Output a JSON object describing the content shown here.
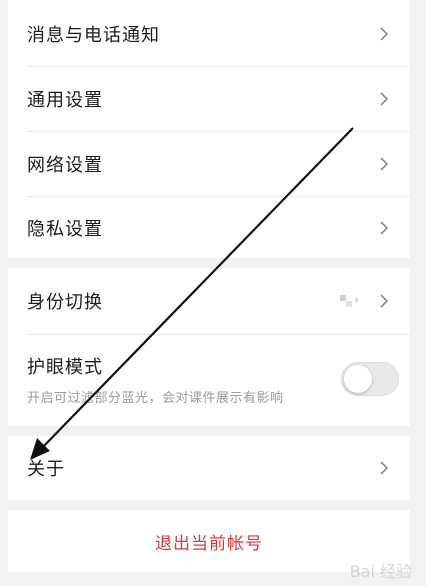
{
  "settings": {
    "group1": [
      {
        "label": "消息与电话通知"
      },
      {
        "label": "通用设置"
      },
      {
        "label": "网络设置"
      },
      {
        "label": "隐私设置"
      }
    ],
    "identity": {
      "label": "身份切换"
    },
    "eye_mode": {
      "label": "护眼模式",
      "description": "开启可过滤部分蓝光，会对课件展示有影响",
      "enabled": false
    },
    "about": {
      "label": "关于"
    },
    "logout": {
      "label": "退出当前帐号"
    }
  },
  "watermark": {
    "text": "Bai 经验"
  },
  "colors": {
    "background": "#f2f2f2",
    "logout_text": "#d33a3a",
    "toggle_off": "#e9e9e9"
  }
}
